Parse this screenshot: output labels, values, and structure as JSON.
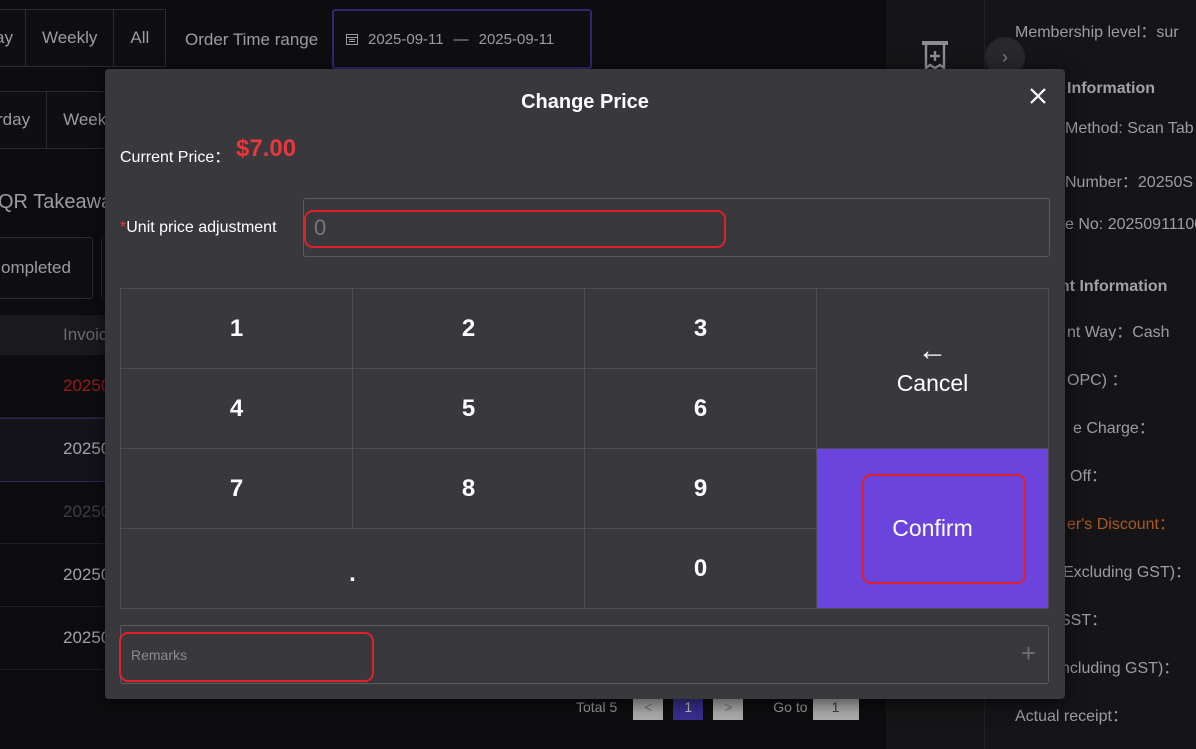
{
  "background": {
    "range_tabs_row1": [
      "ay",
      "Weekly",
      "All"
    ],
    "order_time_range_label": "Order Time range",
    "date_start": "2025-09-11",
    "date_separator": "—",
    "date_end": "2025-09-11",
    "range_tabs_row2": [
      "rday",
      "Week"
    ],
    "section_title": "QR Takeawa",
    "status_tab": "ompleted",
    "list_header": "Invoic",
    "rows": [
      "20250",
      "20250",
      "20250",
      "20250",
      "20250"
    ],
    "pagination": {
      "total": "Total 5",
      "prev": "<",
      "current": "1",
      "next": ">",
      "goto_label": "Go to",
      "goto_value": "1"
    }
  },
  "right_panel": {
    "collapse_icon": "chevron-right-icon",
    "lines": [
      "Membership level：sur",
      "Information",
      "Method: Scan Tab",
      "Number：20250S",
      "e No: 20250911100",
      "ent Information",
      "nt Way：Cash",
      "OPC) ：",
      "e Charge：",
      "Off：",
      "er's Discount：",
      "Excluding GST)：",
      "SST：",
      "ncluding GST)：",
      "Actual receipt："
    ]
  },
  "modal": {
    "title": "Change Price",
    "close_icon": "close-icon",
    "current_price_label": "Current Price：",
    "current_price_value": "$7.00",
    "required_mark": "*",
    "adjust_label": "Unit price adjustment",
    "adjust_placeholder": "0",
    "keys": {
      "k1": "1",
      "k2": "2",
      "k3": "3",
      "k4": "4",
      "k5": "5",
      "k6": "6",
      "k7": "7",
      "k8": "8",
      "k9": "9",
      "dot": ".",
      "k0": "0"
    },
    "cancel_arrow": "←",
    "cancel_label": "Cancel",
    "confirm_label": "Confirm",
    "remarks_placeholder": "Remarks",
    "remarks_add_icon": "+"
  },
  "colors": {
    "accent": "#6a44dd",
    "price_red": "#e8373e",
    "highlight_red": "#e0202a",
    "modal_bg": "#38383d"
  }
}
